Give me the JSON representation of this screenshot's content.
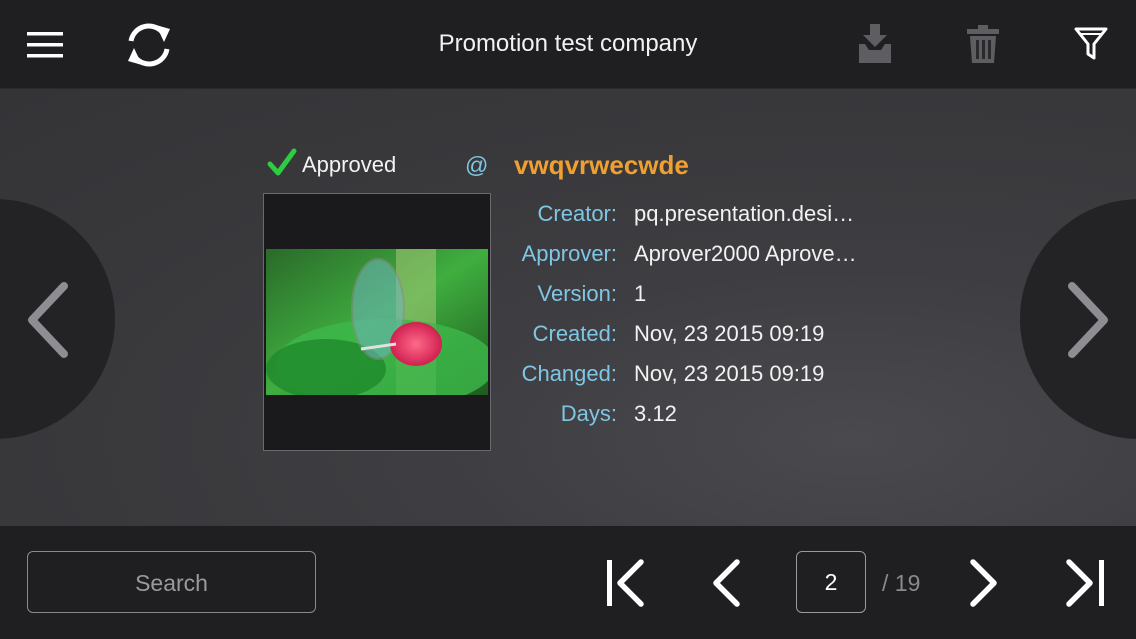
{
  "header": {
    "title": "Promotion test company"
  },
  "item": {
    "status": "Approved",
    "at_symbol": "@",
    "name": "vwqvrwecwde",
    "thumbnail_description_icon": "butterfly-image",
    "fields": [
      {
        "label": "Creator:",
        "value": "pq.presentation.desi…"
      },
      {
        "label": "Approver:",
        "value": "Aprover2000 Aprove…"
      },
      {
        "label": "Version:",
        "value": "1"
      },
      {
        "label": "Created:",
        "value": "Nov, 23 2015 09:19"
      },
      {
        "label": "Changed:",
        "value": "Nov, 23 2015 09:19"
      },
      {
        "label": "Days:",
        "value": "3.12"
      }
    ]
  },
  "footer": {
    "search_label": "Search",
    "page_current": "2",
    "page_total": "/ 19"
  },
  "colors": {
    "accent_label": "#7fc6e4",
    "job_name": "#f0a030",
    "approved_check": "#2ecc40"
  }
}
